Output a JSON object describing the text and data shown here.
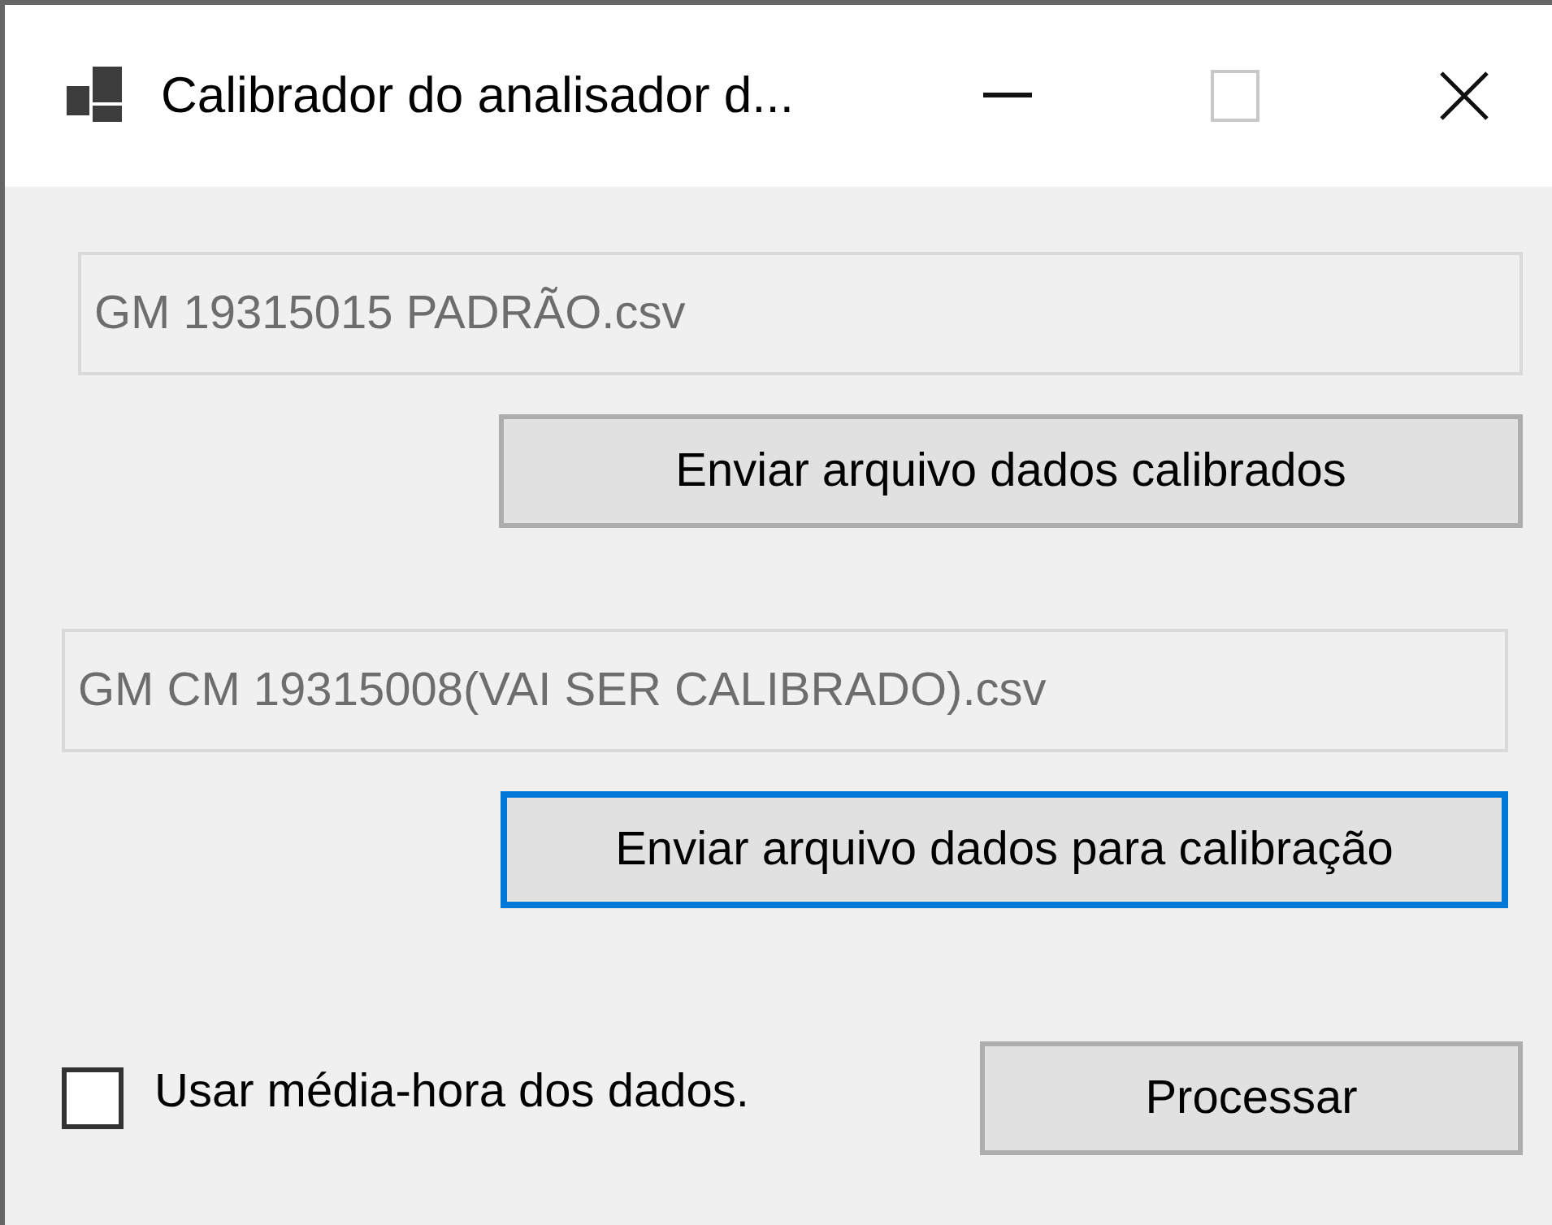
{
  "window": {
    "title": "Calibrador do analisador d..."
  },
  "sections": [
    {
      "field": {
        "value": "GM 19315015 PADRÃO.csv"
      },
      "button": {
        "label": "Enviar arquivo dados calibrados",
        "focused": false
      }
    },
    {
      "field": {
        "value": "GM CM 19315008(VAI SER CALIBRADO).csv"
      },
      "button": {
        "label": "Enviar arquivo dados para calibração",
        "focused": true
      }
    }
  ],
  "checkbox": {
    "label": "Usar média-hora dos dados.",
    "checked": false
  },
  "process_button": {
    "label": "Processar",
    "focused": false
  }
}
